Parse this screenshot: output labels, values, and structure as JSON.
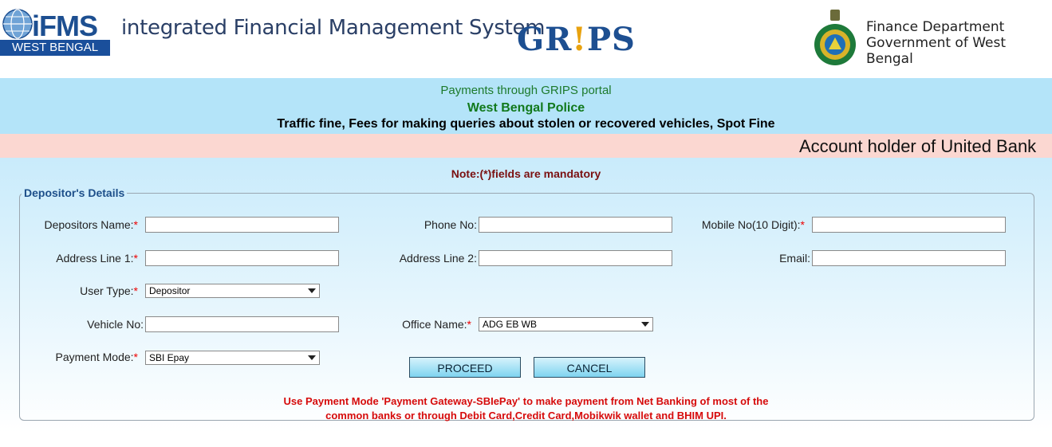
{
  "header": {
    "ifms_text": "iFMS",
    "ifms_band": "WEST BENGAL",
    "system_title": "integrated Financial Management System",
    "grips_pre": "GR",
    "grips_mark": "!",
    "grips_post": "PS",
    "dept_line1": "Finance Department",
    "dept_line2": "Government of West Bengal"
  },
  "banner": {
    "line1": "Payments through GRIPS portal",
    "line2": "West Bengal Police",
    "line3": "Traffic fine, Fees for making queries about stolen or recovered vehicles, Spot Fine"
  },
  "marquee": "Account holder of United Bank",
  "note": "Note:(*)fields are mandatory",
  "form": {
    "legend": "Depositor's Details",
    "depositor_name_label": "Depositors Name:",
    "phone_label": "Phone No:",
    "mobile_label": "Mobile No(10 Digit):",
    "address1_label": "Address Line 1:",
    "address2_label": "Address Line 2:",
    "email_label": "Email:",
    "user_type_label": "User Type:",
    "user_type_value": "Depositor",
    "vehicle_label": "Vehicle No:",
    "office_label": "Office Name:",
    "office_value": "ADG EB WB",
    "payment_mode_label": "Payment Mode:",
    "payment_mode_value": "SBI Epay",
    "required_mark": "*",
    "proceed_label": "PROCEED",
    "cancel_label": "CANCEL",
    "info_line1": "Use Payment Mode 'Payment Gateway-SBIePay' to make payment from Net Banking of most of the",
    "info_line2": "common banks or through Debit Card,Credit Card,Mobikwik wallet and BHIM UPI."
  },
  "colors": {
    "banner_bg": "#b4e4f9",
    "marquee_bg": "#fbd7d1",
    "brand_blue": "#1d4f91",
    "required_red": "#e00000"
  }
}
